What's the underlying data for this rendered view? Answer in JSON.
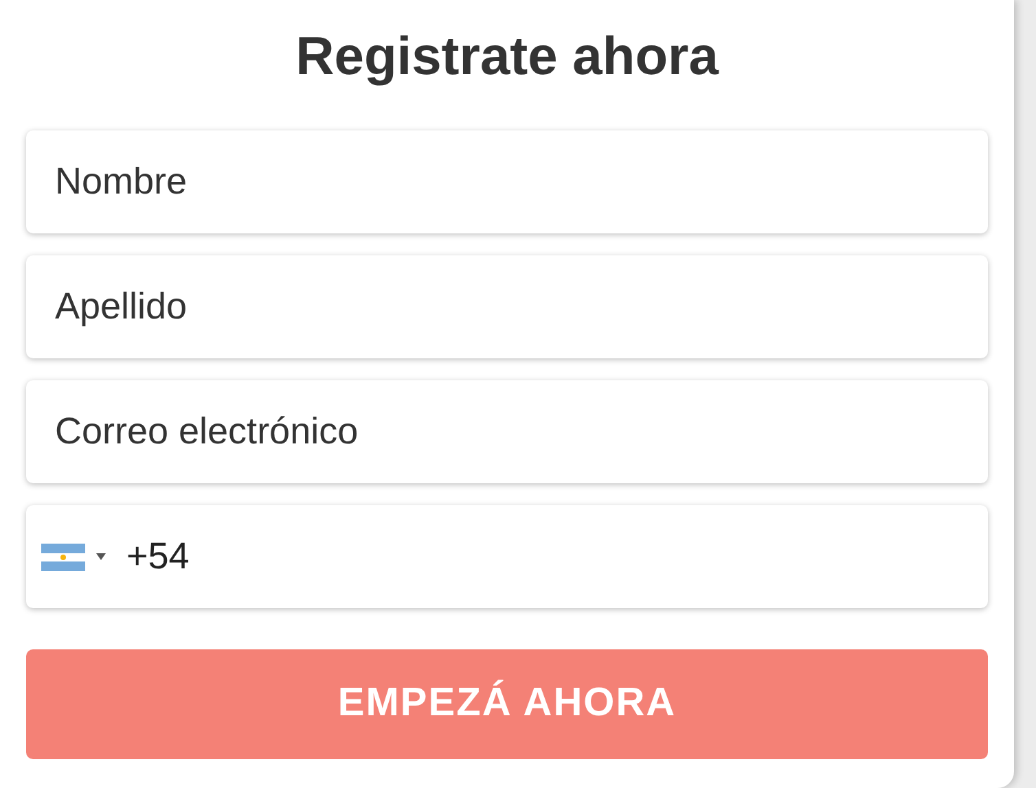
{
  "title": "Registrate ahora",
  "fields": [
    {
      "kind": "text",
      "placeholder": "Nombre"
    },
    {
      "kind": "text",
      "placeholder": "Apellido"
    },
    {
      "kind": "text",
      "placeholder": "Correo electrónico"
    },
    {
      "kind": "phone",
      "value": "+54"
    }
  ],
  "submit_button": "EMPEZÁ AHORA"
}
